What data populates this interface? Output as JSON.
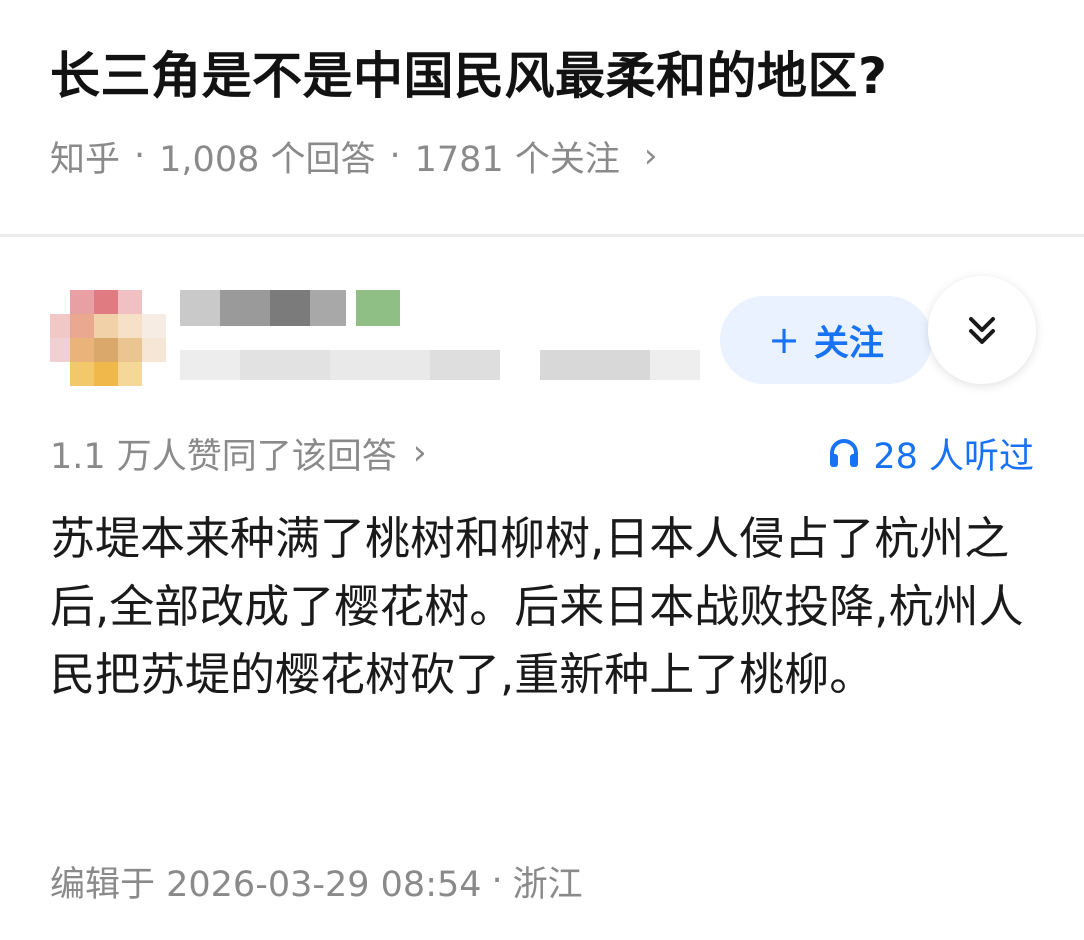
{
  "question": {
    "title": "长三角是不是中国民风最柔和的地区?",
    "source": "知乎",
    "answers": "1,008 个回答",
    "followers": "1781 个关注",
    "separator": "·",
    "chevron": "›"
  },
  "author": {
    "avatar_icon": "pixelated-avatar",
    "name": "",
    "bio": ""
  },
  "actions": {
    "follow_plus": "+",
    "follow_label": "关注",
    "more_icon": "double-chevron-down-icon"
  },
  "stats": {
    "upvote_text": "1.1 万人赞同了该回答",
    "upvote_chevron": "›",
    "listen_icon": "headphones-icon",
    "listen_text": "28 人听过"
  },
  "answer": {
    "content": "苏堤本来种满了桃树和柳树,日本人侵占了杭州之后,全部改成了樱花树。后来日本战败投降,杭州人民把苏堤的樱花树砍了,重新种上了桃柳。"
  },
  "footer": {
    "edited": "编辑于 2026-03-29 08:54",
    "separator": "·",
    "location": "浙江"
  },
  "colors": {
    "accent": "#1772f6",
    "follow_bg": "#eaf2ff",
    "meta_gray": "#8a8a8a",
    "title": "#121212"
  }
}
